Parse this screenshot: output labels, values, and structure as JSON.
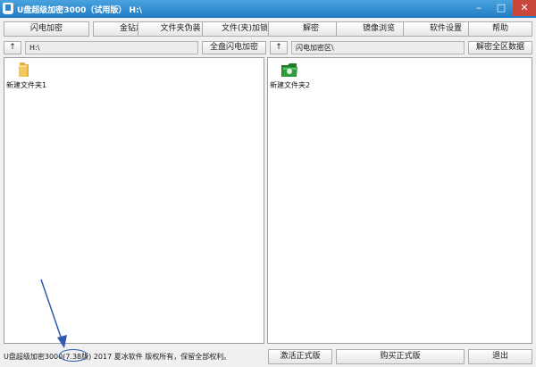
{
  "window": {
    "title": "U盘超级加密3000（试用版）   H:\\",
    "controls": {
      "minimize": "–",
      "maximize": "□",
      "close": "✕"
    }
  },
  "toolbar": {
    "buttons": [
      "闪电加密",
      "金钻加密",
      "文件夹伪装",
      "文件(夹)加锁",
      "解密",
      "镜像浏览",
      "软件设置",
      "帮助"
    ]
  },
  "left_pane": {
    "up_button": "↑",
    "path": "H:\\",
    "action_button": "全盘闪电加密",
    "items": [
      {
        "label": "新建文件夹1",
        "icon": "folder-icon"
      }
    ]
  },
  "right_pane": {
    "up_button": "↑",
    "path": "闪电加密区\\",
    "action_button": "解密全区数据",
    "items": [
      {
        "label": "新建文件夹2",
        "icon": "encrypted-folder-icon"
      }
    ]
  },
  "status": {
    "copyright": "U盘超级加密3000(7.38版) 2017 夏冰软件 版权所有，保留全部权利。",
    "activate_button": "激活正式版",
    "buy_button": "购买正式版",
    "exit_button": "退出"
  },
  "colors": {
    "titlebar": "#2a86cc",
    "annotation": "#2e59b0",
    "folder": "#f2c85b",
    "encrypted_folder": "#2f9b3a"
  }
}
